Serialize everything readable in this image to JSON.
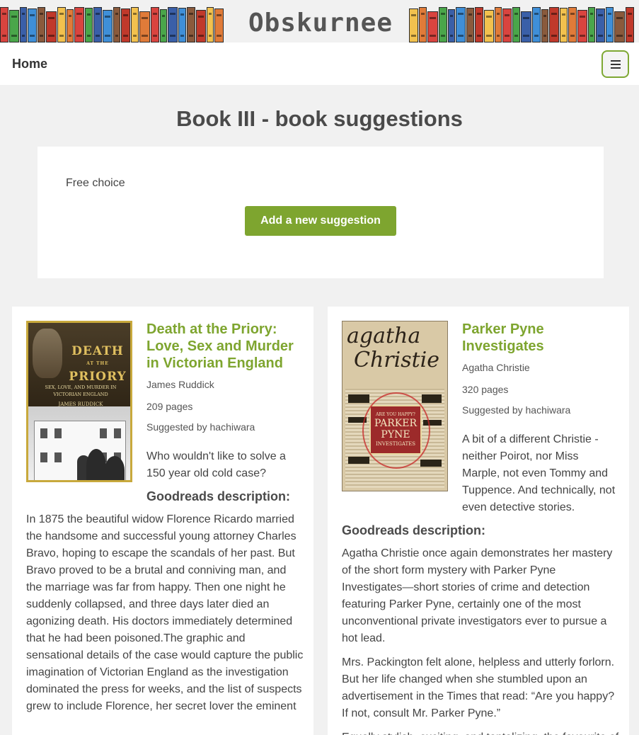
{
  "site": {
    "title": "Obskurnee"
  },
  "nav": {
    "home_label": "Home"
  },
  "page": {
    "title": "Book III - book suggestions"
  },
  "panel": {
    "text": "Free choice",
    "button_label": "Add a new suggestion"
  },
  "colors": {
    "accent": "#7ea52f",
    "background": "#f1f1f1"
  },
  "cards": [
    {
      "title": "Death at the Priory: Love, Sex and Murder in Victorian England",
      "author": "James Ruddick",
      "pages": "209 pages",
      "suggested_by": "Suggested by hachiwara",
      "blurb": "Who wouldn't like to solve a 150 year old cold case?",
      "goodreads_heading": "Goodreads description:",
      "description": [
        "In 1875 the beautiful widow Florence Ricardo married the handsome and successful young attorney Charles Bravo, hoping to escape the scandals of her past. But Bravo proved to be a brutal and conniving man, and the marriage was far from happy. Then one night he suddenly collapsed, and three days later died an agonizing death. His doctors immediately determined that he had been poisoned.The graphic and sensational details of the case would capture the public imagination of Victorian England as the investigation dominated the press for weeks, and the list of suspects grew to include Florence, her secret lover the eminent"
      ],
      "cover": {
        "title_lines": [
          "DEATH",
          "AT THE",
          "PRIORY"
        ],
        "subtitle": "SEX, LOVE, AND MURDER IN VICTORIAN ENGLAND",
        "author": "JAMES RUDDICK"
      }
    },
    {
      "title": "Parker Pyne Investigates",
      "author": "Agatha Christie",
      "pages": "320 pages",
      "suggested_by": "Suggested by hachiwara",
      "blurb": "A bit of a different Christie - neither Poirot, nor Miss Marple, not even Tommy and Tuppence. And technically, not even detective stories.",
      "goodreads_heading": "Goodreads description:",
      "description": [
        "Agatha Christie once again demonstrates her mastery of the short form mystery with Parker Pyne Investigates—short stories of crime and detection featuring Parker Pyne, certainly one of the most unconventional private investigators ever to pursue a hot lead.",
        "Mrs. Packington felt alone, helpless and utterly forlorn. But her life changed when she stumbled upon an advertisement in the Times that read: “Are you happy? If not, consult Mr. Parker Pyne.”",
        "Equally stylish, exciting, and tantalizing, the favourite of"
      ],
      "cover": {
        "handwriting": [
          "agatha",
          "Christie"
        ],
        "label_lines": [
          "ARE YOU HAPPY?",
          "PARKER",
          "PYNE",
          "INVESTIGATES"
        ]
      }
    }
  ]
}
